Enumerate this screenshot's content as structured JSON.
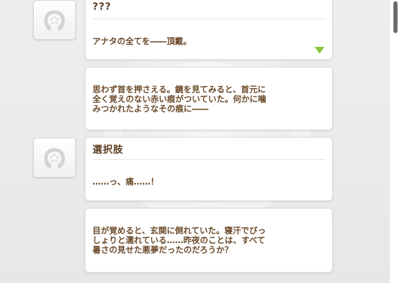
{
  "log": {
    "entries": [
      {
        "speaker": "???",
        "text": "アナタの全てを――頂戴。",
        "has_avatar": true
      },
      {
        "speaker": "",
        "text": "思わず首を押さえる。鏡を見てみると、首元に\n全く覚えのない赤い痕がついていた。何かに噛\nみつかれたようなその痕に――",
        "has_avatar": false
      },
      {
        "speaker": "選択肢",
        "text": "……っ、痛……！",
        "has_avatar": true
      },
      {
        "speaker": "",
        "text": "目が覚めると、玄関に倒れていた。寝汗でびっ\nしょりと濡れている……昨夜のことは、すべて\n暑さの見せた悪夢だったのだろうか？",
        "has_avatar": false
      }
    ]
  },
  "colors": {
    "text_brown": "#6b4a2a",
    "next_indicator": "#8bc53f",
    "scroll_thumb": "#6a6a6a"
  },
  "icons": {
    "avatar": "horseshoe-star-icon",
    "next": "next-triangle-icon"
  }
}
